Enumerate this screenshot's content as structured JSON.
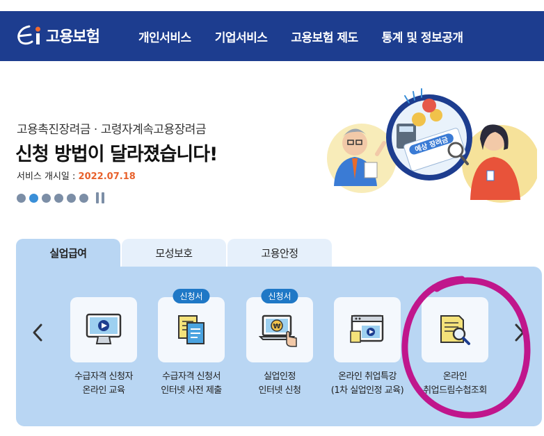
{
  "header": {
    "logo_text": "고용보험",
    "nav": [
      "개인서비스",
      "기업서비스",
      "고용보험 제도",
      "통계 및 정보공개"
    ]
  },
  "banner": {
    "subtitle": "고용촉진장려금 · 고령자계속고용장려금",
    "title": "신청 방법이 달라졌습니다!",
    "date_label": "서비스 개시일 : ",
    "date_value": "2022.07.18",
    "illustration_sign": "예상 장려금",
    "dot_count": 6,
    "active_dot": 1
  },
  "tabs": [
    "실업급여",
    "모성보호",
    "고용안정"
  ],
  "services": [
    {
      "icon": "monitor-play-icon",
      "badge": "",
      "line1": "수급자격 신청자",
      "line2": "온라인 교육"
    },
    {
      "icon": "documents-icon",
      "badge": "신청서",
      "line1": "수급자격 신청서",
      "line2": "인터넷 사전 제출"
    },
    {
      "icon": "laptop-won-icon",
      "badge": "신청서",
      "line1": "실업인정",
      "line2": "인터넷 신청"
    },
    {
      "icon": "browser-video-icon",
      "badge": "",
      "line1": "온라인 취업특강",
      "line2": "(1차 실업인정 교육)"
    },
    {
      "icon": "document-search-icon",
      "badge": "",
      "line1": "온라인",
      "line2": "취업드림수첩조회"
    }
  ],
  "colors": {
    "header_bg": "#1d3d8f",
    "panel_bg": "#b9d6f3",
    "date_accent": "#e8612c",
    "badge_bg": "#1f78c6",
    "annotation": "#c0168c"
  }
}
